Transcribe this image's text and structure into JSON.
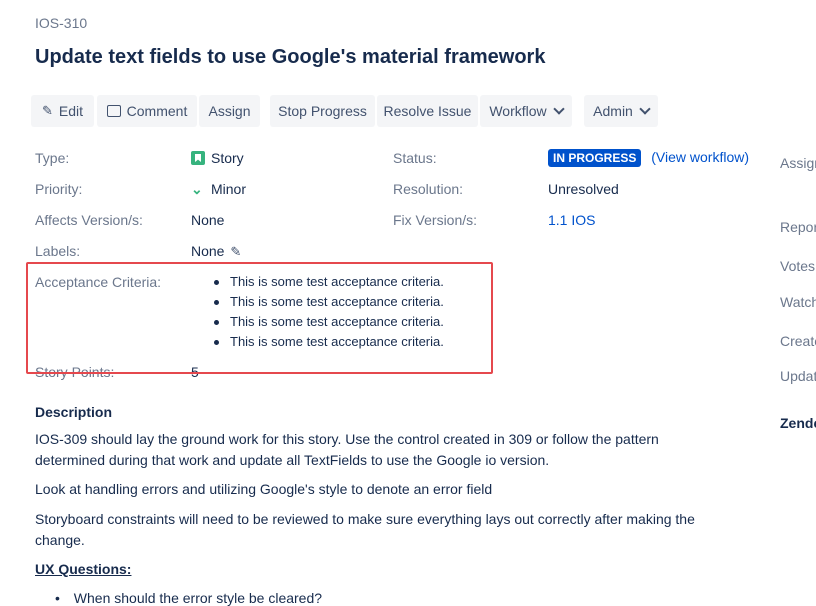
{
  "issue": {
    "key": "IOS-310",
    "title": "Update text fields to use Google's material framework"
  },
  "toolbar": {
    "edit": "Edit",
    "comment": "Comment",
    "assign": "Assign",
    "stop_progress": "Stop Progress",
    "resolve_issue": "Resolve Issue",
    "workflow": "Workflow",
    "admin": "Admin"
  },
  "details": {
    "type_label": "Type:",
    "type_value": "Story",
    "priority_label": "Priority:",
    "priority_value": "Minor",
    "affects_label": "Affects Version/s:",
    "affects_value": "None",
    "labels_label": "Labels:",
    "labels_value": "None",
    "status_label": "Status:",
    "status_value": "IN PROGRESS",
    "view_workflow": "(View workflow)",
    "resolution_label": "Resolution:",
    "resolution_value": "Unresolved",
    "fix_label": "Fix Version/s:",
    "fix_value": "1.1 IOS",
    "acceptance_label": "Acceptance Criteria:",
    "acceptance_items": [
      "This is some test acceptance criteria.",
      "This is some test acceptance criteria.",
      "This is some test acceptance criteria.",
      "This is some test acceptance criteria."
    ],
    "story_points_label": "Story Points:",
    "story_points_value": "5"
  },
  "description": {
    "heading": "Description",
    "p1": "IOS-309 should lay the ground work for this story. Use the control created in 309 or follow the pattern determined during that work and update all TextFields to use the Google io version.",
    "p2": "Look at handling errors and utilizing Google's style to denote an error field",
    "p3": "Storyboard constraints will need to be reviewed to make sure everything lays out correctly after making the change.",
    "ux_heading": "UX Questions:",
    "ux_item1": "When should the error style be cleared?"
  },
  "sidebar": {
    "assignee": "Assignee:",
    "reporter": "Reporter:",
    "votes": "Votes:",
    "watchers": "Watchers:",
    "created": "Created:",
    "updated": "Updated:",
    "zendesk": "Zendesk"
  },
  "colors": {
    "accent": "#0052cc",
    "highlight": "#e5484d",
    "story": "#36b37e"
  }
}
